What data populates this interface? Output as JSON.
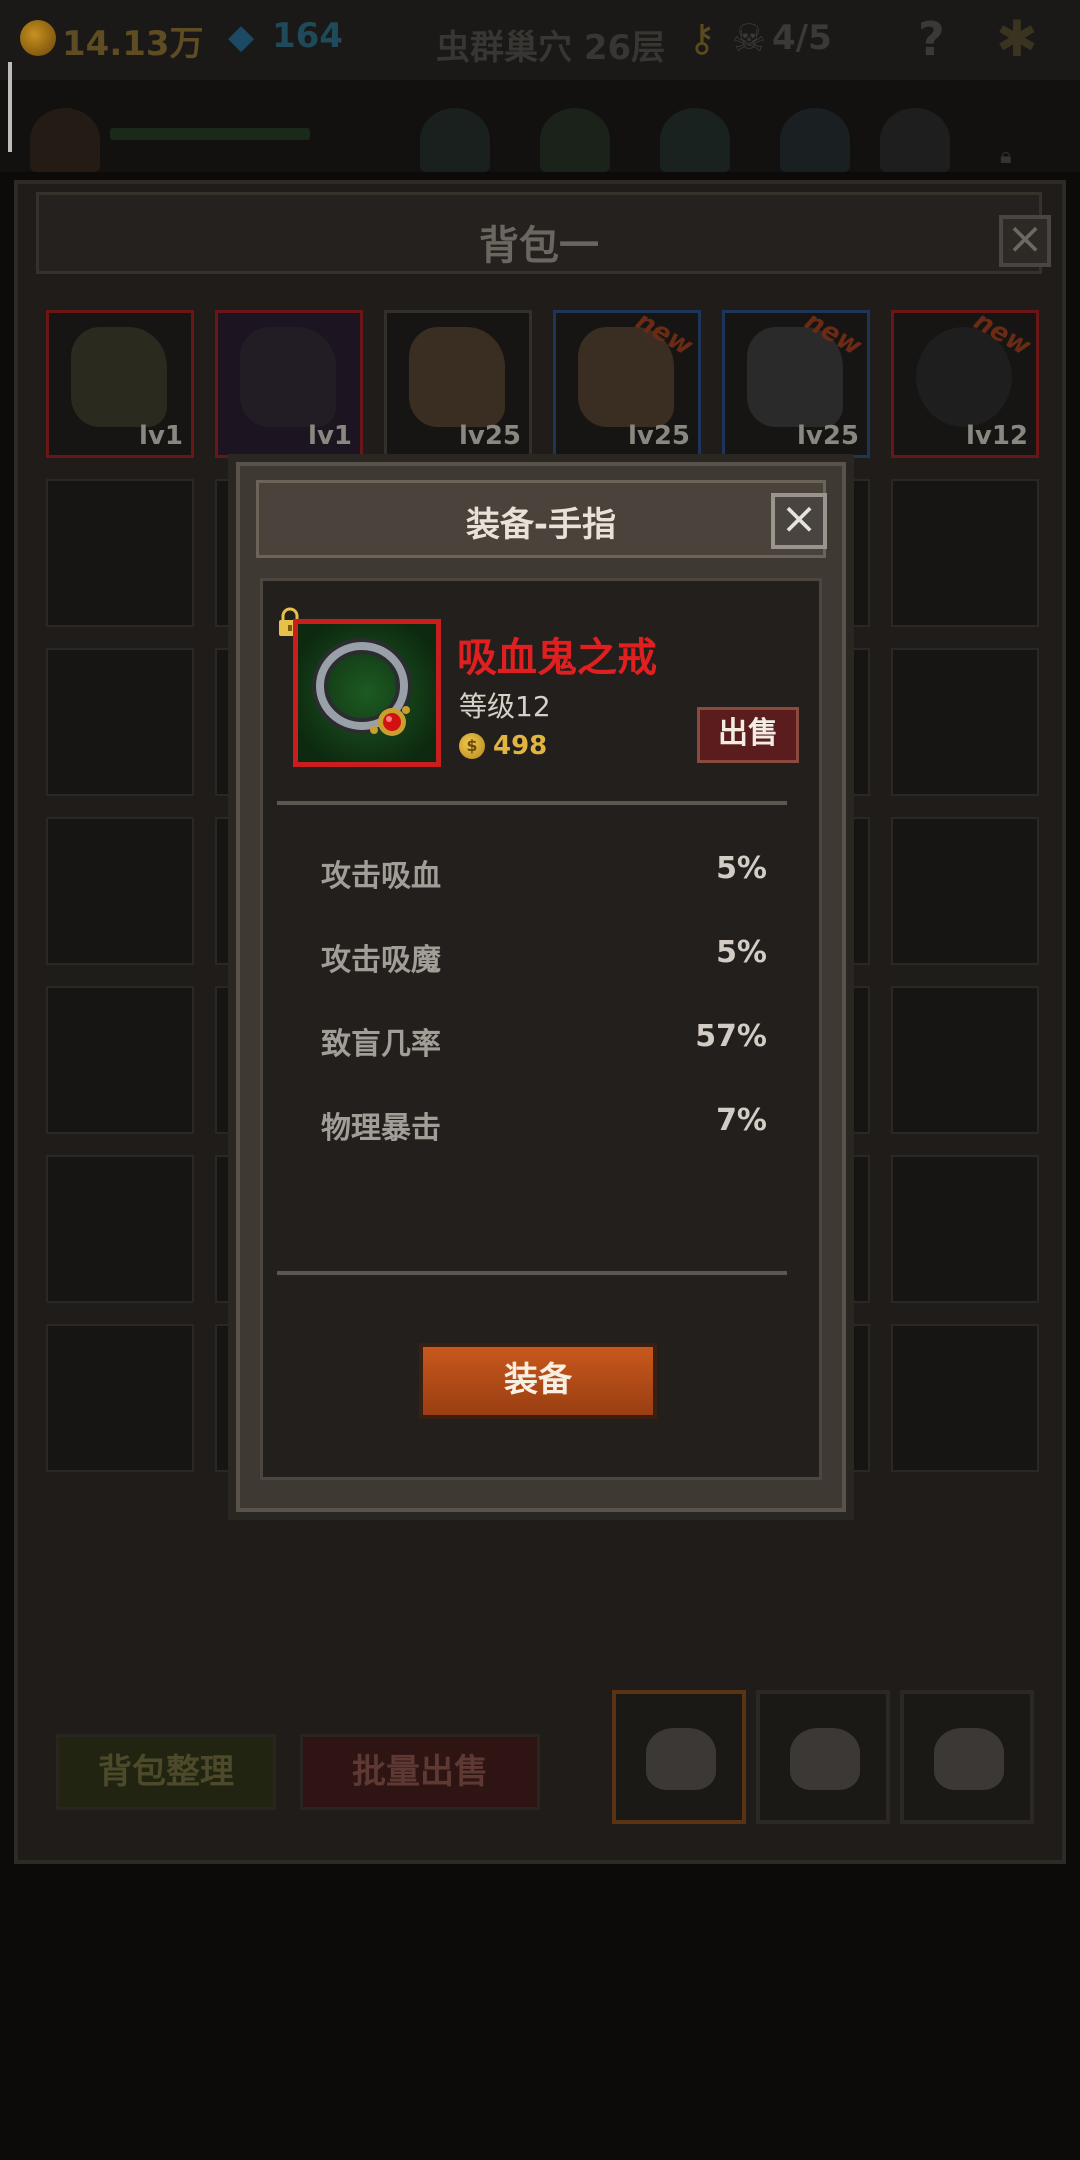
{
  "hud": {
    "gold": "14.13万",
    "gems": "164",
    "floor": "虫群巢穴 26层",
    "skulls": "4/5",
    "help": "?"
  },
  "bag": {
    "title": "背包一",
    "close": "×",
    "items": [
      {
        "level": "lv1",
        "is_new": false,
        "rarity_color": "#8a1818"
      },
      {
        "level": "lv1",
        "is_new": false,
        "rarity_color": "#8a1818"
      },
      {
        "level": "lv25",
        "is_new": false,
        "rarity_color": "#3a3835"
      },
      {
        "level": "lv25",
        "is_new": true,
        "rarity_color": "#1e3a62"
      },
      {
        "level": "lv25",
        "is_new": true,
        "rarity_color": "#1e3a62"
      },
      {
        "level": "lv12",
        "is_new": true,
        "rarity_color": "#8a1818"
      }
    ],
    "new_label": "new",
    "sort_label": "背包整理",
    "bulk_sell_label": "批量出售"
  },
  "modal": {
    "title": "装备-手指",
    "close": "×",
    "item": {
      "name": "吸血鬼之戒",
      "level_text": "等级12",
      "price": "498",
      "sell_label": "出售",
      "rarity_color": "#c81e1e"
    },
    "stats": [
      {
        "label": "攻击吸血",
        "value": "5%"
      },
      {
        "label": "攻击吸魔",
        "value": "5%"
      },
      {
        "label": "致盲几率",
        "value": "57%"
      },
      {
        "label": "物理暴击",
        "value": "7%"
      }
    ],
    "equip_label": "装备"
  }
}
